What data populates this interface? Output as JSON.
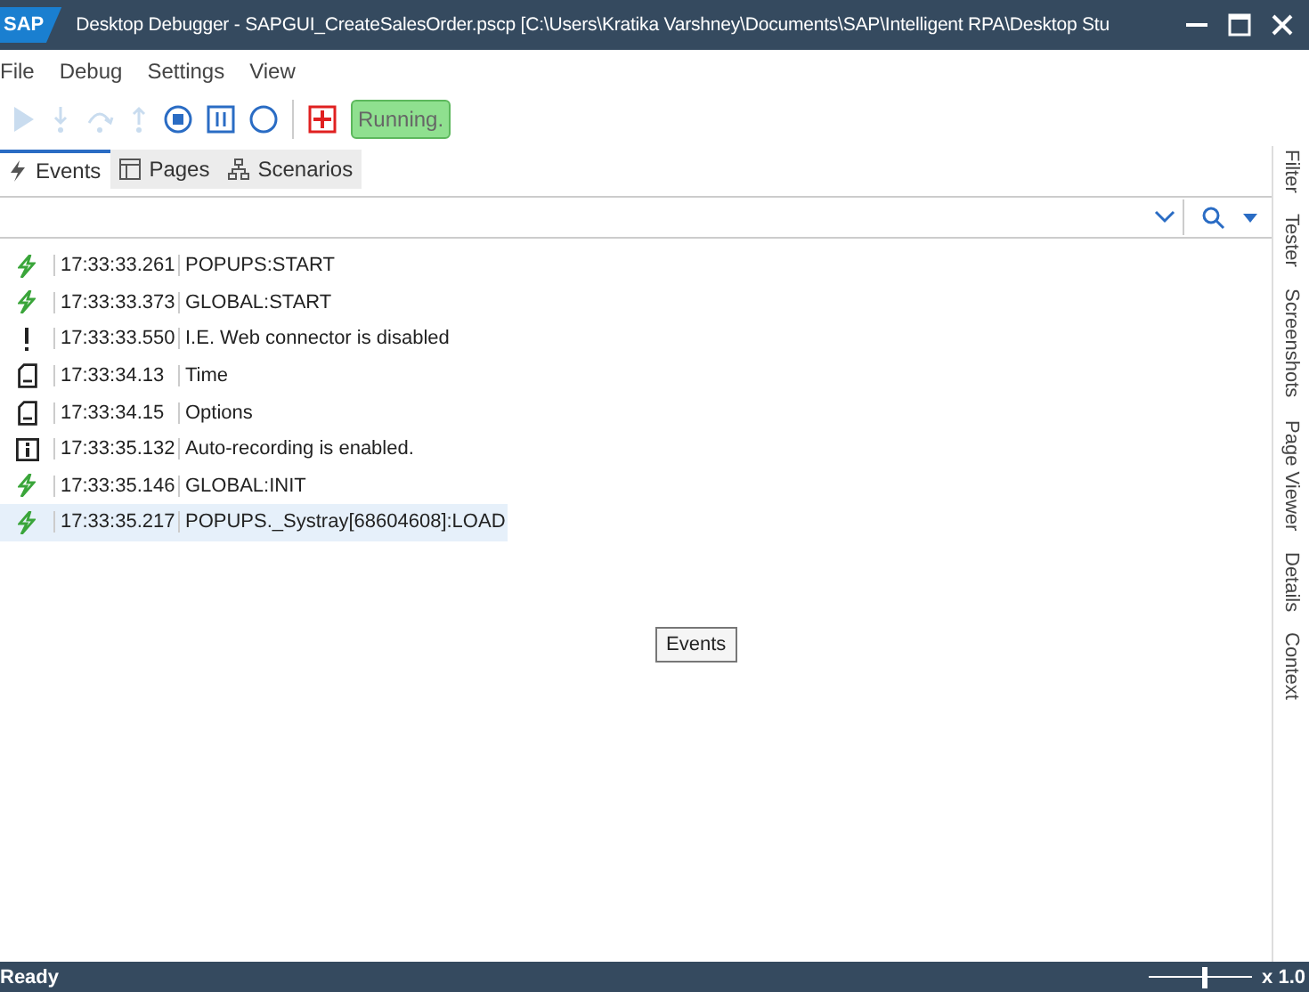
{
  "window": {
    "title": "Desktop Debugger - SAPGUI_CreateSalesOrder.pscp [C:\\Users\\Kratika Varshney\\Documents\\SAP\\Intelligent RPA\\Desktop Stu",
    "logo": "SAP"
  },
  "menu": [
    "File",
    "Debug",
    "Settings",
    "View"
  ],
  "toolbar": {
    "status": "Running."
  },
  "tabs": [
    {
      "label": "Events",
      "kind": "bolt",
      "selected": true
    },
    {
      "label": "Pages",
      "kind": "page",
      "selected": false
    },
    {
      "label": "Scenarios",
      "kind": "tree",
      "selected": false
    }
  ],
  "side_tabs": [
    "Filter",
    "Tester",
    "Screenshots",
    "Page Viewer",
    "Details",
    "Context"
  ],
  "events": [
    {
      "kind": "event",
      "time": "17:33:33.261",
      "text": "POPUPS:START",
      "selected": false
    },
    {
      "kind": "event",
      "time": "17:33:33.373",
      "text": "GLOBAL:START",
      "selected": false
    },
    {
      "kind": "warning",
      "time": "17:33:33.550",
      "text": "I.E. Web connector is disabled",
      "selected": false
    },
    {
      "kind": "page",
      "time": "17:33:34.13",
      "text": "Time",
      "selected": false
    },
    {
      "kind": "page",
      "time": "17:33:34.15",
      "text": "Options",
      "selected": false
    },
    {
      "kind": "info",
      "time": "17:33:35.132",
      "text": "Auto-recording is enabled.",
      "selected": false
    },
    {
      "kind": "event",
      "time": "17:33:35.146",
      "text": "GLOBAL:INIT",
      "selected": false
    },
    {
      "kind": "event",
      "time": "17:33:35.217",
      "text": "POPUPS._Systray[68604608]:LOAD",
      "selected": true
    }
  ],
  "tooltip": "Events",
  "status_bar": {
    "text": "Ready",
    "zoom": {
      "level": 0.55
    },
    "zoom_label": "x 1.0"
  }
}
